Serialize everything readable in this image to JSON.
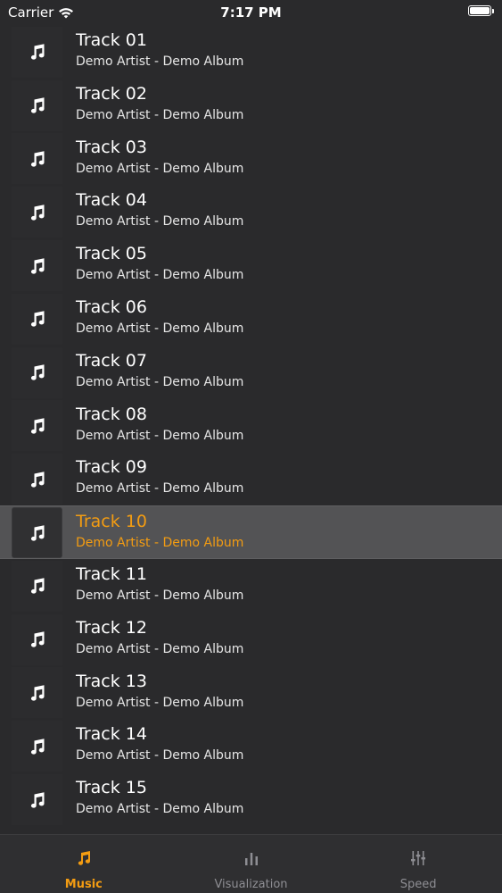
{
  "status_bar": {
    "carrier": "Carrier",
    "time": "7:17 PM"
  },
  "colors": {
    "background": "#2a2a2c",
    "accent": "#f39c12",
    "selected_row": "#535355",
    "inactive_tab": "#8e8e93"
  },
  "tracks": [
    {
      "title": "Track 01",
      "subtitle": "Demo Artist - Demo Album",
      "icon": "music-note-icon"
    },
    {
      "title": "Track 02",
      "subtitle": "Demo Artist - Demo Album",
      "icon": "music-note-icon"
    },
    {
      "title": "Track 03",
      "subtitle": "Demo Artist - Demo Album",
      "icon": "music-note-icon"
    },
    {
      "title": "Track 04",
      "subtitle": "Demo Artist - Demo Album",
      "icon": "music-note-icon"
    },
    {
      "title": "Track 05",
      "subtitle": "Demo Artist - Demo Album",
      "icon": "music-note-icon"
    },
    {
      "title": "Track 06",
      "subtitle": "Demo Artist - Demo Album",
      "icon": "music-note-icon"
    },
    {
      "title": "Track 07",
      "subtitle": "Demo Artist - Demo Album",
      "icon": "music-note-icon"
    },
    {
      "title": "Track 08",
      "subtitle": "Demo Artist - Demo Album",
      "icon": "music-note-icon"
    },
    {
      "title": "Track 09",
      "subtitle": "Demo Artist - Demo Album",
      "icon": "music-note-icon"
    },
    {
      "title": "Track 10",
      "subtitle": "Demo Artist - Demo Album",
      "icon": "music-note-icon",
      "selected": true
    },
    {
      "title": "Track 11",
      "subtitle": "Demo Artist - Demo Album",
      "icon": "music-note-icon"
    },
    {
      "title": "Track 12",
      "subtitle": "Demo Artist - Demo Album",
      "icon": "music-note-icon"
    },
    {
      "title": "Track 13",
      "subtitle": "Demo Artist - Demo Album",
      "icon": "music-note-icon"
    },
    {
      "title": "Track 14",
      "subtitle": "Demo Artist - Demo Album",
      "icon": "music-note-icon"
    },
    {
      "title": "Track 15",
      "subtitle": "Demo Artist - Demo Album",
      "icon": "music-note-icon"
    }
  ],
  "tab_bar": {
    "tabs": [
      {
        "label": "Music",
        "icon": "music-note-icon",
        "active": true
      },
      {
        "label": "Visualization",
        "icon": "bar-chart-icon",
        "active": false
      },
      {
        "label": "Speed",
        "icon": "sliders-icon",
        "active": false
      }
    ]
  }
}
